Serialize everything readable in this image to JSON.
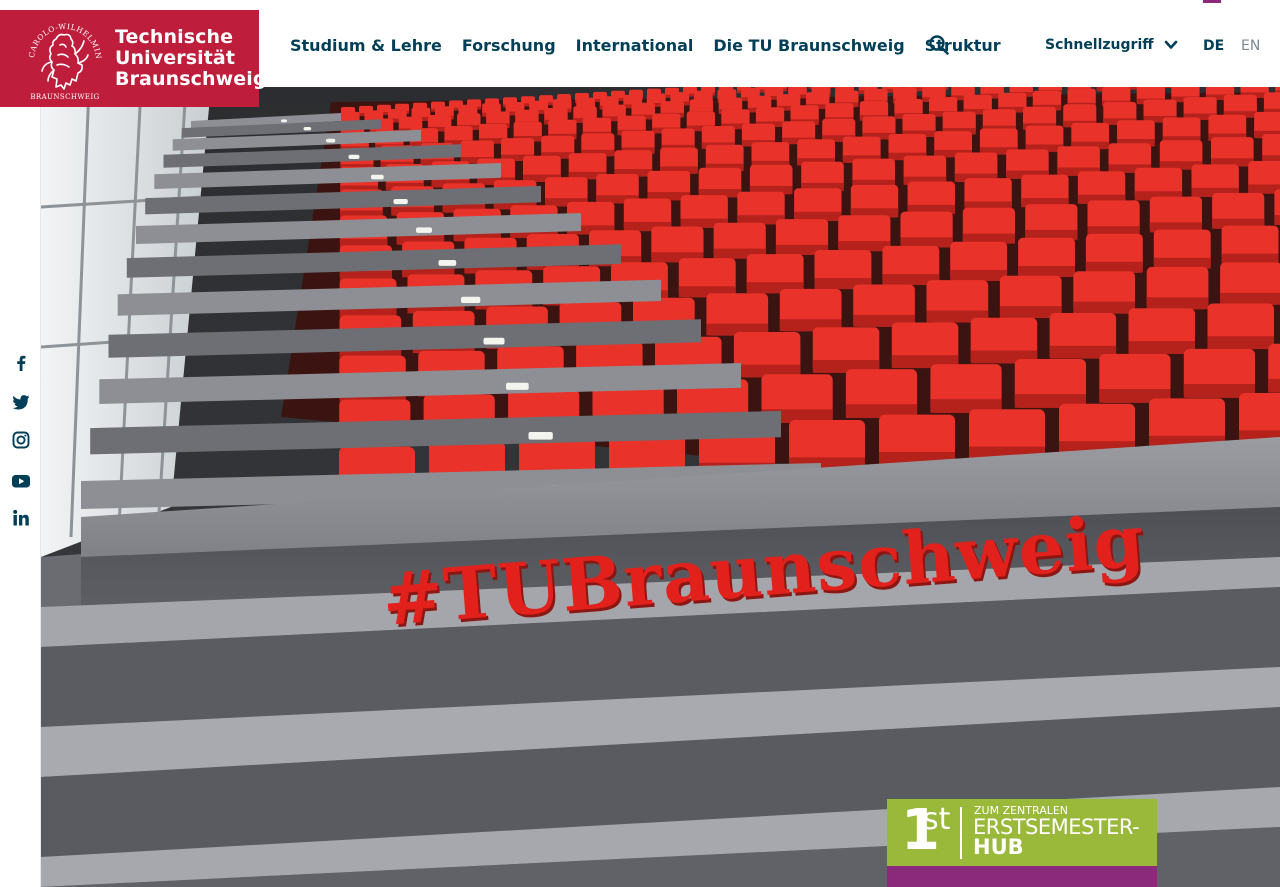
{
  "header": {
    "logo": {
      "line1": "Technische",
      "line2": "Universität",
      "line3": "Braunschweig",
      "seal_text": "CAROLO-WILHELMINA · BRAUNSCHWEIG"
    },
    "nav": [
      {
        "label": "Studium & Lehre"
      },
      {
        "label": "Forschung"
      },
      {
        "label": "International"
      },
      {
        "label": "Die TU Braunschweig"
      },
      {
        "label": "Struktur"
      }
    ],
    "search_icon": "search-icon",
    "quick_access": {
      "label": "Schnellzugriff",
      "icon": "chevron-down-icon"
    },
    "languages": [
      {
        "label": "DE",
        "active": true
      },
      {
        "label": "EN",
        "active": false
      }
    ]
  },
  "social": [
    {
      "icon": "facebook-icon"
    },
    {
      "icon": "twitter-icon"
    },
    {
      "icon": "instagram-icon"
    },
    {
      "icon": "youtube-icon"
    },
    {
      "icon": "linkedin-icon"
    }
  ],
  "hero": {
    "hashtag": "#TUBraunschweig"
  },
  "badge": {
    "number": "1",
    "superscript": "st",
    "line1": "ZUM ZENTRALEN",
    "line2": "ERSTSEMESTER-",
    "line3": "HUB"
  },
  "colors": {
    "brand_red": "#be1e3c",
    "nav_text": "#003f57",
    "badge_green": "#9ab93b",
    "badge_purple": "#8b2a7b",
    "seat_red": "#e8322a"
  }
}
